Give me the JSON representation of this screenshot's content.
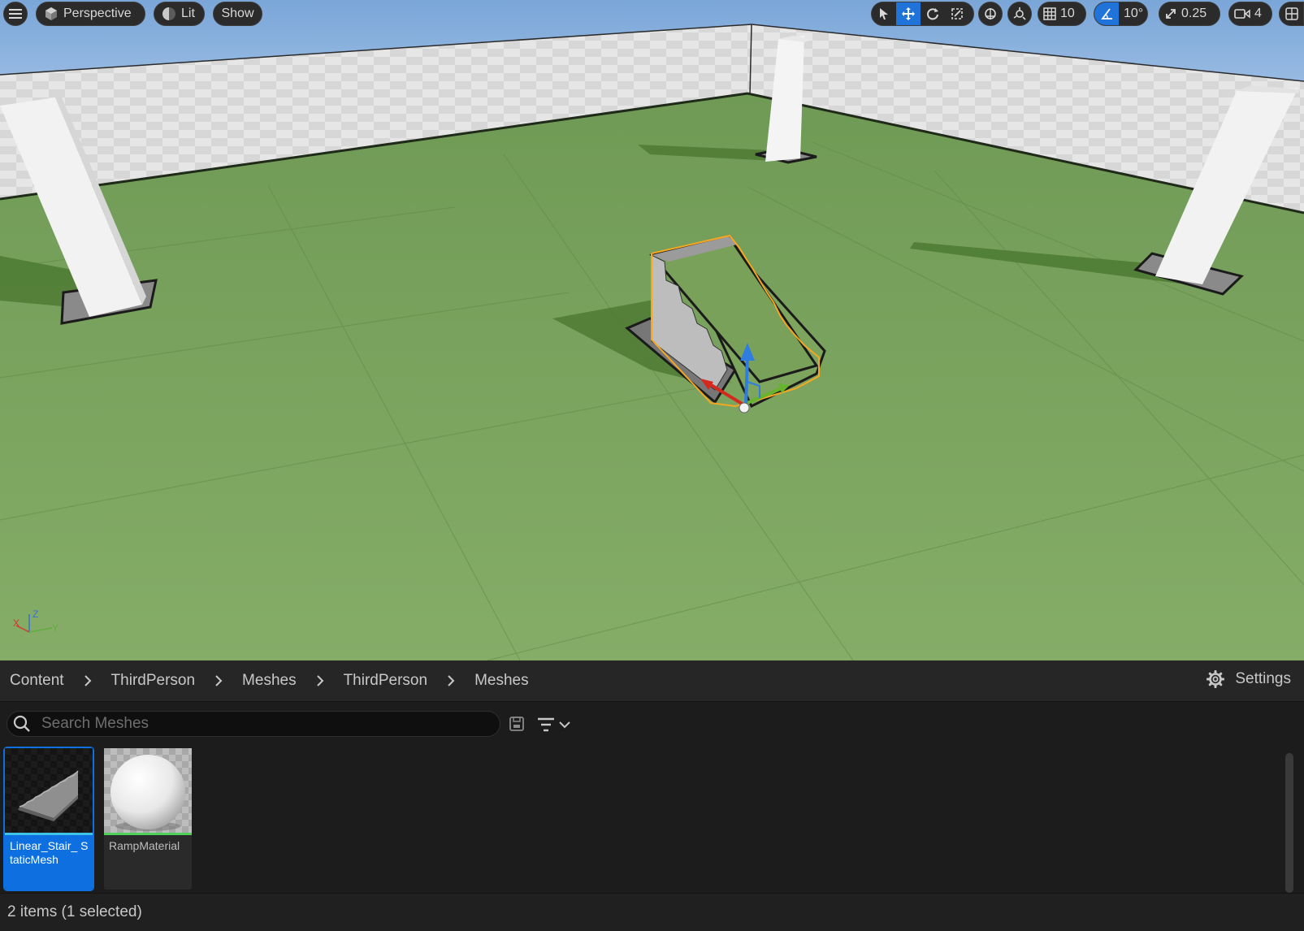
{
  "viewport": {
    "menu_icon": "hamburger-icon",
    "view_mode": {
      "icon": "cube-icon",
      "label": "Perspective"
    },
    "lighting": {
      "icon": "lit-sphere-icon",
      "label": "Lit"
    },
    "show_label": "Show",
    "transform_tools": [
      {
        "icon": "select-arrow-icon",
        "active": false
      },
      {
        "icon": "move-icon",
        "active": true
      },
      {
        "icon": "rotate-icon",
        "active": false
      },
      {
        "icon": "scale-icon",
        "active": false
      }
    ],
    "grid_snap_value": "10",
    "rotation_snap_value": "10°",
    "scale_snap_value": "0.25",
    "camera_speed_value": "4",
    "axis_labels": {
      "x": "X",
      "y": "Y",
      "z": "Z"
    }
  },
  "content_browser": {
    "breadcrumbs": [
      "Content",
      "ThirdPerson",
      "Meshes",
      "ThirdPerson",
      "Meshes"
    ],
    "settings_label": "Settings",
    "search_placeholder": "Search Meshes",
    "assets": [
      {
        "name": "Linear_Stair_ StaticMesh",
        "selected": true,
        "type_color": "#3fc1e8"
      },
      {
        "name": "RampMaterial",
        "selected": false,
        "type_color": "#4fd05a"
      }
    ],
    "status_text": "2 items (1 selected)"
  },
  "colors": {
    "accent": "#0e70e0",
    "selection_outline": "#f5a623",
    "floor": "#7aa35c",
    "sky": "#8fb4de"
  }
}
